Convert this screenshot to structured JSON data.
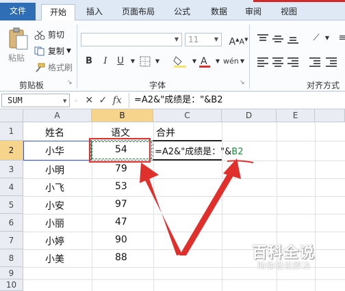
{
  "ribbon": {
    "tabs": [
      "文件",
      "开始",
      "插入",
      "页面布局",
      "公式",
      "数据",
      "审阅",
      "视图"
    ],
    "clipboard": {
      "paste": "粘贴",
      "cut": "剪切",
      "copy": "复制",
      "format_painter": "格式刷",
      "group_label": "剪贴板"
    },
    "font": {
      "size": "11",
      "group_label": "字体",
      "bold": "B",
      "italic": "I",
      "underline": "U"
    },
    "alignment": {
      "group_label": "对齐方式"
    }
  },
  "formula_bar": {
    "name_box": "SUM",
    "formula": "=A2&\"成绩是：\"&B2",
    "fx": "fx"
  },
  "columns": [
    "A",
    "B",
    "C",
    "D",
    "E"
  ],
  "rows": [
    "1",
    "2",
    "3",
    "4",
    "5",
    "6",
    "7",
    "8",
    "9",
    "10"
  ],
  "cells": {
    "a1": "姓名",
    "b1": "语文",
    "c1": "合并",
    "a2": "小华",
    "b2": "54",
    "a3": "小明",
    "b3": "79",
    "a4": "小飞",
    "b4": "53",
    "a5": "小安",
    "b5": "97",
    "a6": "小丽",
    "b6": "47",
    "a7": "小婷",
    "b7": "90",
    "a8": "小美",
    "b8": "88",
    "c2_part1": "=A2&\"成绩是：\"&",
    "c2_part2": "B2"
  },
  "watermark": {
    "title": "百科全说",
    "subtitle": "助你轻松解决"
  },
  "colors": {
    "accent_red": "#e0302c",
    "file_tab": "#2f6db5",
    "header_highlight": "#f6d48b",
    "ref_green": "#1a8a3a"
  }
}
